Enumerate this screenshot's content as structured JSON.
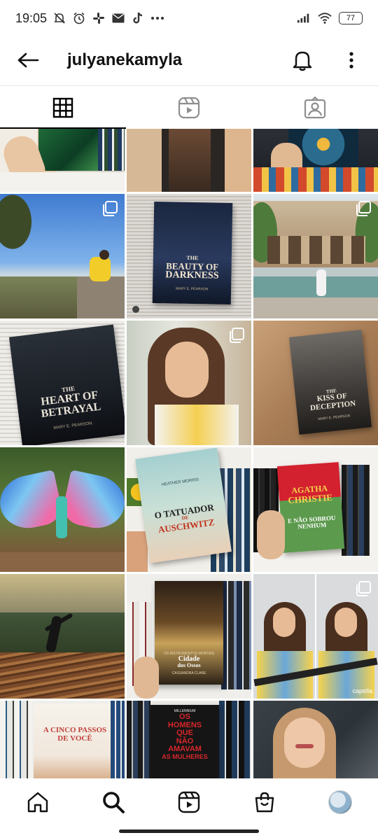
{
  "status_bar": {
    "time": "19:05",
    "battery": "77",
    "left_icons": [
      "mute-icon",
      "alarm-icon",
      "slack-icon",
      "mail-icon",
      "tiktok-icon",
      "more-dots-icon"
    ],
    "right_icons": [
      "signal-icon",
      "wifi-icon",
      "battery-icon"
    ]
  },
  "header": {
    "username": "julyanekamyla",
    "icons": [
      "back-arrow-icon",
      "bell-icon",
      "more-vertical-icon"
    ]
  },
  "tabs": [
    {
      "name": "posts",
      "icon": "grid-icon",
      "active": true
    },
    {
      "name": "reels",
      "icon": "reels-icon",
      "active": false
    },
    {
      "name": "tagged",
      "icon": "tagged-person-icon",
      "active": false
    }
  ],
  "grid": {
    "books": {
      "beauty": {
        "line1": "THE",
        "line2": "BEAUTY OF",
        "line3": "DARKNESS",
        "author": "MARY E. PEARSON"
      },
      "heart": {
        "line1": "THE",
        "line2": "HEART OF",
        "line3": "BETRAYAL",
        "author": "MARY E. PEARSON"
      },
      "kiss": {
        "line1": "THE",
        "line2": "KISS OF",
        "line3": "DECEPTION",
        "author": "MARY E. PEARSON"
      },
      "tatuador": {
        "author": "HEATHER MORRIS",
        "line1": "O TATUADOR",
        "line2": "DE",
        "line3": "AUSCHWITZ"
      },
      "agatha": {
        "line1": "AGATHA",
        "line2": "CHRISTIE",
        "line3": "E NÃO SOBROU NENHUM"
      },
      "cidade": {
        "series": "OS INSTRUMENTOS MORTAIS",
        "line1": "Cidade",
        "line2": "dos Ossos",
        "author": "CASSANDRA CLARE"
      },
      "cinco": {
        "line1": "A CINCO PASSOS",
        "line2": "DE VOCÊ"
      },
      "millennium": {
        "series": "MILLENNIUM",
        "line1": "OS",
        "line2": "HOMENS",
        "line3": "QUE",
        "line4": "NÃO",
        "line5": "AMAVAM",
        "line6": "AS MULHERES"
      }
    },
    "watermark": "capella",
    "multi_icon": "carousel-icon"
  },
  "bottom_nav": [
    {
      "name": "home",
      "icon": "home-icon"
    },
    {
      "name": "search",
      "icon": "search-icon",
      "active": true
    },
    {
      "name": "reels",
      "icon": "reels-icon"
    },
    {
      "name": "shop",
      "icon": "shop-bag-icon"
    },
    {
      "name": "profile",
      "icon": "profile-avatar-icon"
    }
  ],
  "colors": {
    "accent": "#000000",
    "divider": "#e6e6e6"
  }
}
